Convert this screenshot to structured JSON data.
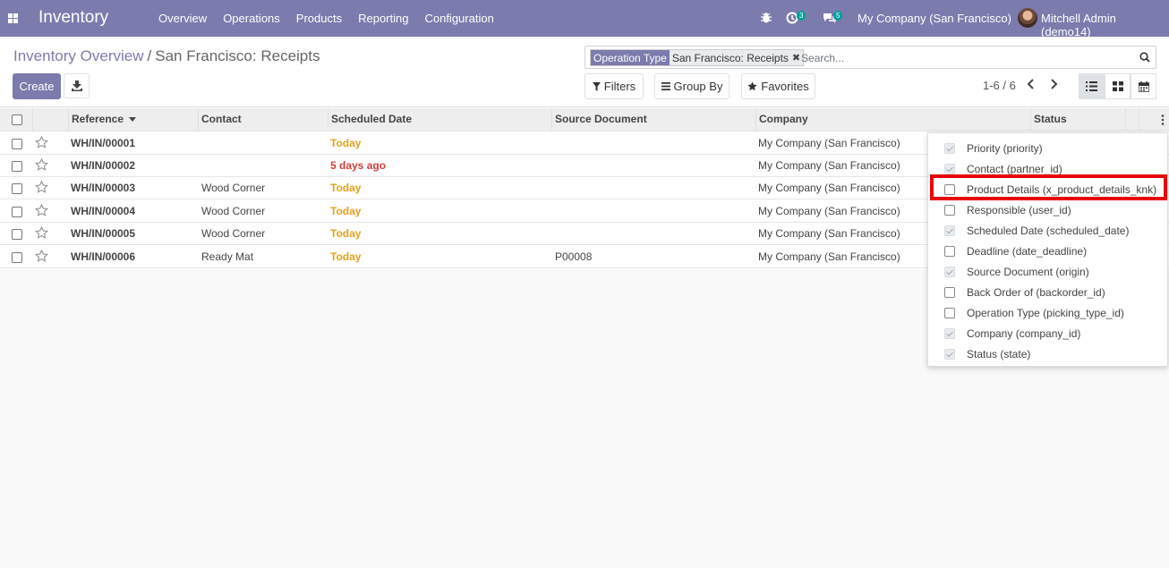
{
  "navbar": {
    "brand": "Inventory",
    "menu": [
      "Overview",
      "Operations",
      "Products",
      "Reporting",
      "Configuration"
    ],
    "activity_count": "3",
    "message_count": "5",
    "company": "My Company (San Francisco)",
    "user": "Mitchell Admin (demo14)",
    "color": "#7c7bad"
  },
  "breadcrumb": {
    "parent": "Inventory Overview",
    "separator": "/",
    "current": "San Francisco: Receipts"
  },
  "buttons": {
    "create": "Create"
  },
  "search": {
    "facet_label": "Operation Type",
    "facet_value": "San Francisco: Receipts",
    "facet_remove": "✖",
    "placeholder": "Search..."
  },
  "filters": {
    "filters": "Filters",
    "group_by": "Group By",
    "favorites": "Favorites"
  },
  "pager": {
    "value": "1-6 / 6"
  },
  "table": {
    "columns": [
      "Reference",
      "Contact",
      "Scheduled Date",
      "Source Document",
      "Company",
      "Status"
    ],
    "rows": [
      {
        "reference": "WH/IN/00001",
        "contact": "",
        "date": "Today",
        "source": "",
        "company": "My Company (San Francisco)"
      },
      {
        "reference": "WH/IN/00002",
        "contact": "",
        "date": "5 days ago",
        "source": "",
        "company": "My Company (San Francisco)"
      },
      {
        "reference": "WH/IN/00003",
        "contact": "Wood Corner",
        "date": "Today",
        "source": "",
        "company": "My Company (San Francisco)"
      },
      {
        "reference": "WH/IN/00004",
        "contact": "Wood Corner",
        "date": "Today",
        "source": "",
        "company": "My Company (San Francisco)"
      },
      {
        "reference": "WH/IN/00005",
        "contact": "Wood Corner",
        "date": "Today",
        "source": "",
        "company": "My Company (San Francisco)"
      },
      {
        "reference": "WH/IN/00006",
        "contact": "Ready Mat",
        "date": "Today",
        "source": "P00008",
        "company": "My Company (San Francisco)"
      }
    ]
  },
  "optional_columns": [
    {
      "label": "Priority (priority)",
      "checked": true
    },
    {
      "label": "Contact (partner_id)",
      "checked": true
    },
    {
      "label": "Product Details (x_product_details_knk)",
      "checked": false
    },
    {
      "label": "Responsible (user_id)",
      "checked": false
    },
    {
      "label": "Scheduled Date (scheduled_date)",
      "checked": true
    },
    {
      "label": "Deadline (date_deadline)",
      "checked": false
    },
    {
      "label": "Source Document (origin)",
      "checked": true
    },
    {
      "label": "Back Order of (backorder_id)",
      "checked": false
    },
    {
      "label": "Operation Type (picking_type_id)",
      "checked": false
    },
    {
      "label": "Company (company_id)",
      "checked": true
    },
    {
      "label": "Status (state)",
      "checked": true
    }
  ]
}
